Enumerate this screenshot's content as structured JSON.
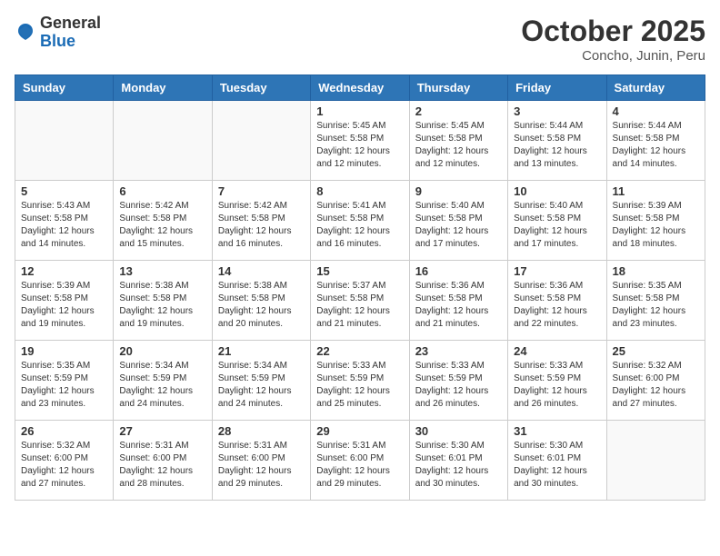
{
  "header": {
    "logo_general": "General",
    "logo_blue": "Blue",
    "title": "October 2025",
    "subtitle": "Concho, Junin, Peru"
  },
  "calendar": {
    "days_of_week": [
      "Sunday",
      "Monday",
      "Tuesday",
      "Wednesday",
      "Thursday",
      "Friday",
      "Saturday"
    ],
    "weeks": [
      [
        {
          "day": "",
          "info": ""
        },
        {
          "day": "",
          "info": ""
        },
        {
          "day": "",
          "info": ""
        },
        {
          "day": "1",
          "info": "Sunrise: 5:45 AM\nSunset: 5:58 PM\nDaylight: 12 hours\nand 12 minutes."
        },
        {
          "day": "2",
          "info": "Sunrise: 5:45 AM\nSunset: 5:58 PM\nDaylight: 12 hours\nand 12 minutes."
        },
        {
          "day": "3",
          "info": "Sunrise: 5:44 AM\nSunset: 5:58 PM\nDaylight: 12 hours\nand 13 minutes."
        },
        {
          "day": "4",
          "info": "Sunrise: 5:44 AM\nSunset: 5:58 PM\nDaylight: 12 hours\nand 14 minutes."
        }
      ],
      [
        {
          "day": "5",
          "info": "Sunrise: 5:43 AM\nSunset: 5:58 PM\nDaylight: 12 hours\nand 14 minutes."
        },
        {
          "day": "6",
          "info": "Sunrise: 5:42 AM\nSunset: 5:58 PM\nDaylight: 12 hours\nand 15 minutes."
        },
        {
          "day": "7",
          "info": "Sunrise: 5:42 AM\nSunset: 5:58 PM\nDaylight: 12 hours\nand 16 minutes."
        },
        {
          "day": "8",
          "info": "Sunrise: 5:41 AM\nSunset: 5:58 PM\nDaylight: 12 hours\nand 16 minutes."
        },
        {
          "day": "9",
          "info": "Sunrise: 5:40 AM\nSunset: 5:58 PM\nDaylight: 12 hours\nand 17 minutes."
        },
        {
          "day": "10",
          "info": "Sunrise: 5:40 AM\nSunset: 5:58 PM\nDaylight: 12 hours\nand 17 minutes."
        },
        {
          "day": "11",
          "info": "Sunrise: 5:39 AM\nSunset: 5:58 PM\nDaylight: 12 hours\nand 18 minutes."
        }
      ],
      [
        {
          "day": "12",
          "info": "Sunrise: 5:39 AM\nSunset: 5:58 PM\nDaylight: 12 hours\nand 19 minutes."
        },
        {
          "day": "13",
          "info": "Sunrise: 5:38 AM\nSunset: 5:58 PM\nDaylight: 12 hours\nand 19 minutes."
        },
        {
          "day": "14",
          "info": "Sunrise: 5:38 AM\nSunset: 5:58 PM\nDaylight: 12 hours\nand 20 minutes."
        },
        {
          "day": "15",
          "info": "Sunrise: 5:37 AM\nSunset: 5:58 PM\nDaylight: 12 hours\nand 21 minutes."
        },
        {
          "day": "16",
          "info": "Sunrise: 5:36 AM\nSunset: 5:58 PM\nDaylight: 12 hours\nand 21 minutes."
        },
        {
          "day": "17",
          "info": "Sunrise: 5:36 AM\nSunset: 5:58 PM\nDaylight: 12 hours\nand 22 minutes."
        },
        {
          "day": "18",
          "info": "Sunrise: 5:35 AM\nSunset: 5:58 PM\nDaylight: 12 hours\nand 23 minutes."
        }
      ],
      [
        {
          "day": "19",
          "info": "Sunrise: 5:35 AM\nSunset: 5:59 PM\nDaylight: 12 hours\nand 23 minutes."
        },
        {
          "day": "20",
          "info": "Sunrise: 5:34 AM\nSunset: 5:59 PM\nDaylight: 12 hours\nand 24 minutes."
        },
        {
          "day": "21",
          "info": "Sunrise: 5:34 AM\nSunset: 5:59 PM\nDaylight: 12 hours\nand 24 minutes."
        },
        {
          "day": "22",
          "info": "Sunrise: 5:33 AM\nSunset: 5:59 PM\nDaylight: 12 hours\nand 25 minutes."
        },
        {
          "day": "23",
          "info": "Sunrise: 5:33 AM\nSunset: 5:59 PM\nDaylight: 12 hours\nand 26 minutes."
        },
        {
          "day": "24",
          "info": "Sunrise: 5:33 AM\nSunset: 5:59 PM\nDaylight: 12 hours\nand 26 minutes."
        },
        {
          "day": "25",
          "info": "Sunrise: 5:32 AM\nSunset: 6:00 PM\nDaylight: 12 hours\nand 27 minutes."
        }
      ],
      [
        {
          "day": "26",
          "info": "Sunrise: 5:32 AM\nSunset: 6:00 PM\nDaylight: 12 hours\nand 27 minutes."
        },
        {
          "day": "27",
          "info": "Sunrise: 5:31 AM\nSunset: 6:00 PM\nDaylight: 12 hours\nand 28 minutes."
        },
        {
          "day": "28",
          "info": "Sunrise: 5:31 AM\nSunset: 6:00 PM\nDaylight: 12 hours\nand 29 minutes."
        },
        {
          "day": "29",
          "info": "Sunrise: 5:31 AM\nSunset: 6:00 PM\nDaylight: 12 hours\nand 29 minutes."
        },
        {
          "day": "30",
          "info": "Sunrise: 5:30 AM\nSunset: 6:01 PM\nDaylight: 12 hours\nand 30 minutes."
        },
        {
          "day": "31",
          "info": "Sunrise: 5:30 AM\nSunset: 6:01 PM\nDaylight: 12 hours\nand 30 minutes."
        },
        {
          "day": "",
          "info": ""
        }
      ]
    ]
  }
}
